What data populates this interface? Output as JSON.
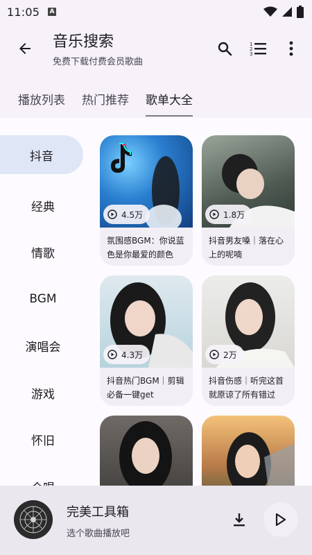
{
  "status": {
    "time": "11:05",
    "badge": "A"
  },
  "app_bar": {
    "title": "音乐搜索",
    "subtitle": "免费下载付费会员歌曲"
  },
  "tabs": [
    {
      "label": "播放列表",
      "active": false
    },
    {
      "label": "热门推荐",
      "active": false
    },
    {
      "label": "歌单大全",
      "active": true
    }
  ],
  "categories": [
    {
      "label": "抖音",
      "active": true
    },
    {
      "label": "经典",
      "active": false
    },
    {
      "label": "情歌",
      "active": false
    },
    {
      "label": "BGM",
      "active": false
    },
    {
      "label": "演唱会",
      "active": false
    },
    {
      "label": "游戏",
      "active": false
    },
    {
      "label": "怀旧",
      "active": false
    },
    {
      "label": "合唱",
      "active": false
    }
  ],
  "playlists": [
    {
      "plays": "4.5万",
      "name": "氛围感BGM：你说蓝色是你最爱的颜色"
    },
    {
      "plays": "1.8万",
      "name": "抖音男友嗓｜落在心上的呢喃"
    },
    {
      "plays": "4.3万",
      "name": "抖音热门BGM｜剪辑必备一键get"
    },
    {
      "plays": "2万",
      "name": "抖音伤感｜听完这首就原谅了所有错过"
    },
    {
      "plays": "",
      "name": ""
    },
    {
      "plays": "",
      "name": ""
    }
  ],
  "player": {
    "title": "完美工具箱",
    "subtitle": "选个歌曲播放吧"
  },
  "colors": {
    "background": "#f7f2fa",
    "active_category": "#dfe6f6",
    "card": "#f1eef5",
    "player": "#eae7ee"
  }
}
